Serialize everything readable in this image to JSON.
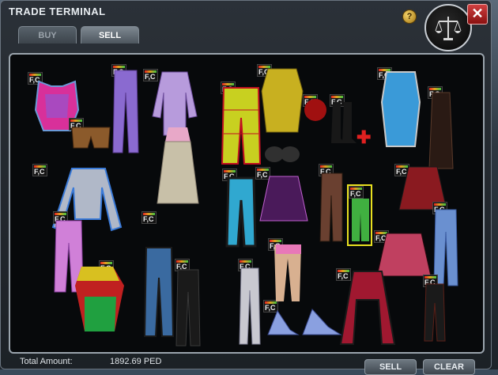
{
  "window": {
    "title": "TRADE TERMINAL",
    "help_label": "?",
    "close_label": "✕"
  },
  "tabs": [
    {
      "label": "BUY",
      "active": false
    },
    {
      "label": "SELL",
      "active": true
    }
  ],
  "items": [
    {
      "icon": "pink-corset-top-icon",
      "tag": "F,C",
      "color": "#d8309a"
    },
    {
      "icon": "brown-shorts-icon",
      "tag": "F,C",
      "color": "#8b5a2b"
    },
    {
      "icon": "purple-pants-icon",
      "tag": "F,C",
      "color": "#8a6ad0"
    },
    {
      "icon": "lilac-shirt-icon",
      "tag": "F,C",
      "color": "#b79bdc"
    },
    {
      "icon": "yellow-plaid-pants-icon",
      "tag": "F,C",
      "color": "#c8d020"
    },
    {
      "icon": "yellow-mesh-top-icon",
      "tag": "F,C",
      "color": "#c8b020"
    },
    {
      "icon": "red-bag-icon",
      "tag": "F,C",
      "color": "#a01010"
    },
    {
      "icon": "blue-white-top-icon",
      "tag": "F,C",
      "color": "#3a9ad8"
    },
    {
      "icon": "black-long-coat-icon",
      "tag": "F,C",
      "color": "#2a1a14"
    },
    {
      "icon": "silver-blue-top-icon",
      "tag": "F,C",
      "color": "#b0b8c8"
    },
    {
      "icon": "pink-beige-dress-icon",
      "tag": "F,C",
      "color": "#e8a8c8"
    },
    {
      "icon": "black-bra-icon",
      "tag": "F,C",
      "color": "#303030"
    },
    {
      "icon": "black-purple-skirt-icon",
      "tag": "F,C",
      "color": "#4a1a5a"
    },
    {
      "icon": "black-boots-icon",
      "tag": "F,C",
      "color": "#181818"
    },
    {
      "icon": "cyan-striped-leggings-icon",
      "tag": "F,C",
      "color": "#30a8d0"
    },
    {
      "icon": "green-stockings-icon",
      "tag": "F,C",
      "color": "#40b040"
    },
    {
      "icon": "red-black-skirt-icon",
      "tag": "F,C",
      "color": "#8a1a20"
    },
    {
      "icon": "blue-jeans-icon",
      "tag": "F,C",
      "color": "#6a90d0"
    },
    {
      "icon": "pink-leggings-icon",
      "tag": "F,C",
      "color": "#d080d8"
    },
    {
      "icon": "rasta-top-icon",
      "tag": "F,C",
      "color": "#d8c020"
    },
    {
      "icon": "blue-black-pants-icon",
      "tag": "F,C",
      "color": "#3a6aa0"
    },
    {
      "icon": "silver-pants-icon",
      "tag": "F,C",
      "color": "#c8c8d0"
    },
    {
      "icon": "pink-striped-skirt-icon",
      "tag": "F,C",
      "color": "#c04060"
    },
    {
      "icon": "red-black-jacket-icon",
      "tag": "F,C",
      "color": "#a01830"
    },
    {
      "icon": "black-pants-icon",
      "tag": "F,C",
      "color": "#1a1a1a"
    },
    {
      "icon": "blue-heels-icon",
      "tag": "F,C",
      "color": "#8aa0e0"
    },
    {
      "icon": "tan-legs-boots-icon",
      "tag": "F,C",
      "color": "#d8b090"
    },
    {
      "icon": "maroon-pants-icon",
      "tag": "F,C",
      "color": "#5a2018"
    }
  ],
  "footer": {
    "total_label": "Total Amount:",
    "total_value": "1892.69 PED",
    "sell_label": "SELL",
    "clear_label": "CLEAR"
  }
}
